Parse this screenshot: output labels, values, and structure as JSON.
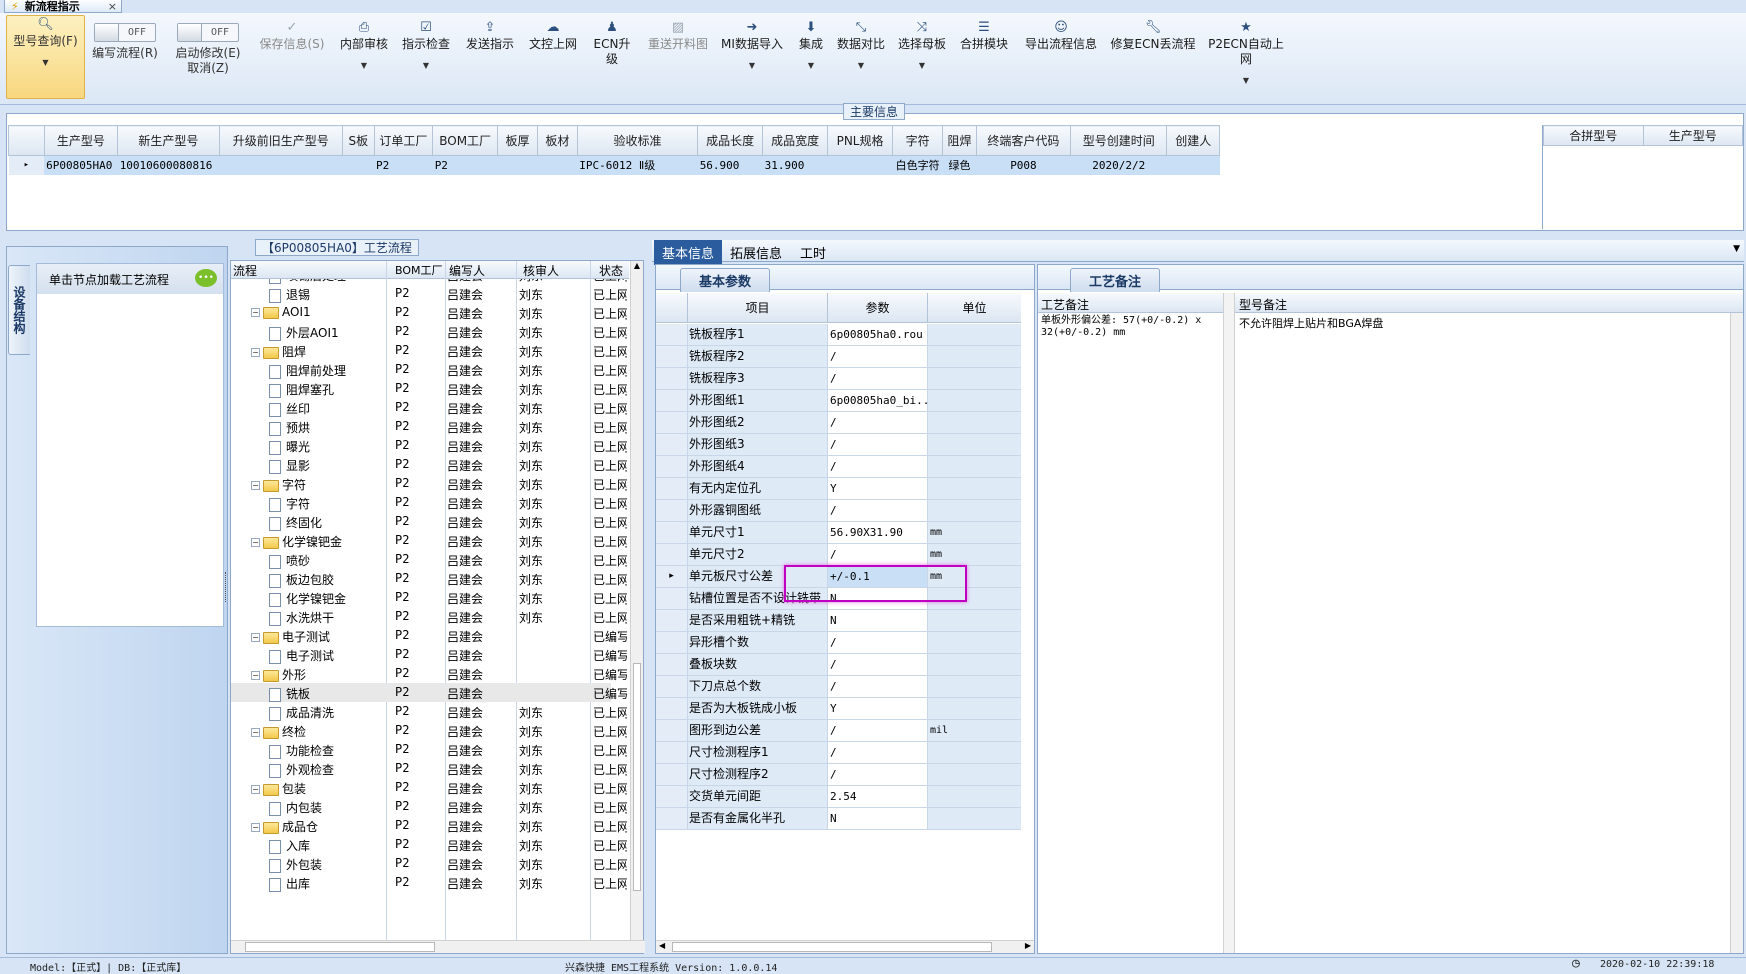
{
  "doc_tab": {
    "title": "新流程指示",
    "close": "×"
  },
  "toolbar": {
    "query": "型号查询(F)",
    "write_flow": "编写流程(R)",
    "start_edit": "启动修改(E)",
    "cancel": "取消(Z)",
    "off": "OFF",
    "save_info": "保存信息(S)",
    "internal_review": "内部审核",
    "instruction_check": "指示检查",
    "send_instruction": "发送指示",
    "doc_upload": "文控上网",
    "ecn_upgrade": "ECN升级",
    "resend_material": "重送开料图",
    "mi_import": "MI数据导入",
    "integrate": "集成",
    "data_compare": "数据对比",
    "select_master": "选择母板",
    "merge_module": "合拼模块",
    "export_flow": "导出流程信息",
    "repair_ecn": "修复ECN丢流程",
    "p2ecn_upload": "P2ECN自动上网"
  },
  "main_info": {
    "section_title": "主要信息",
    "columns": [
      "生产型号",
      "新生产型号",
      "升级前旧生产型号",
      "S板",
      "订单工厂",
      "BOM工厂",
      "板厚",
      "板材",
      "验收标准",
      "成品长度",
      "成品宽度",
      "PNL规格",
      "字符",
      "阻焊",
      "终端客户代码",
      "型号创建时间",
      "创建人"
    ],
    "row": [
      "6P00805HA0",
      "10010600080816",
      "",
      "",
      "P2",
      "P2",
      "",
      "",
      "IPC-6012 Ⅱ级",
      "56.900",
      "31.900",
      "",
      "白色字符",
      "绿色",
      "P008",
      "2020/2/2",
      ""
    ],
    "side_columns": [
      "合拼型号",
      "生产型号"
    ]
  },
  "left_panel": {
    "vertical_tab": "设备结构",
    "hint": "单击节点加载工艺流程"
  },
  "flow": {
    "title": "【6P00805HA0】工艺流程",
    "columns": [
      "流程",
      "BOM工厂",
      "编写人",
      "核审人",
      "状态"
    ],
    "rows": [
      {
        "name": "喷锡后处理",
        "level": 1,
        "f": "P2",
        "w": "吕建会",
        "r": "刘东",
        "s": "已上网"
      },
      {
        "name": "退锡",
        "level": 1,
        "f": "P2",
        "w": "吕建会",
        "r": "刘东",
        "s": "已上网"
      },
      {
        "name": "AOI1",
        "level": 0,
        "f": "P2",
        "w": "吕建会",
        "r": "刘东",
        "s": "已上网"
      },
      {
        "name": "外层AOI1",
        "level": 1,
        "f": "P2",
        "w": "吕建会",
        "r": "刘东",
        "s": "已上网"
      },
      {
        "name": "阻焊",
        "level": 0,
        "f": "P2",
        "w": "吕建会",
        "r": "刘东",
        "s": "已上网"
      },
      {
        "name": "阻焊前处理",
        "level": 1,
        "f": "P2",
        "w": "吕建会",
        "r": "刘东",
        "s": "已上网"
      },
      {
        "name": "阻焊塞孔",
        "level": 1,
        "f": "P2",
        "w": "吕建会",
        "r": "刘东",
        "s": "已上网"
      },
      {
        "name": "丝印",
        "level": 1,
        "f": "P2",
        "w": "吕建会",
        "r": "刘东",
        "s": "已上网"
      },
      {
        "name": "预烘",
        "level": 1,
        "f": "P2",
        "w": "吕建会",
        "r": "刘东",
        "s": "已上网"
      },
      {
        "name": "曝光",
        "level": 1,
        "f": "P2",
        "w": "吕建会",
        "r": "刘东",
        "s": "已上网"
      },
      {
        "name": "显影",
        "level": 1,
        "f": "P2",
        "w": "吕建会",
        "r": "刘东",
        "s": "已上网"
      },
      {
        "name": "字符",
        "level": 0,
        "f": "P2",
        "w": "吕建会",
        "r": "刘东",
        "s": "已上网"
      },
      {
        "name": "字符",
        "level": 1,
        "f": "P2",
        "w": "吕建会",
        "r": "刘东",
        "s": "已上网"
      },
      {
        "name": "终固化",
        "level": 1,
        "f": "P2",
        "w": "吕建会",
        "r": "刘东",
        "s": "已上网"
      },
      {
        "name": "化学镍钯金",
        "level": 0,
        "f": "P2",
        "w": "吕建会",
        "r": "刘东",
        "s": "已上网"
      },
      {
        "name": "喷砂",
        "level": 1,
        "f": "P2",
        "w": "吕建会",
        "r": "刘东",
        "s": "已上网"
      },
      {
        "name": "板边包胶",
        "level": 1,
        "f": "P2",
        "w": "吕建会",
        "r": "刘东",
        "s": "已上网"
      },
      {
        "name": "化学镍钯金",
        "level": 1,
        "f": "P2",
        "w": "吕建会",
        "r": "刘东",
        "s": "已上网"
      },
      {
        "name": "水洗烘干",
        "level": 1,
        "f": "P2",
        "w": "吕建会",
        "r": "刘东",
        "s": "已上网"
      },
      {
        "name": "电子测试",
        "level": 0,
        "f": "P2",
        "w": "吕建会",
        "r": "",
        "s": "已编写"
      },
      {
        "name": "电子测试",
        "level": 1,
        "f": "P2",
        "w": "吕建会",
        "r": "",
        "s": "已编写"
      },
      {
        "name": "外形",
        "level": 0,
        "f": "P2",
        "w": "吕建会",
        "r": "",
        "s": "已编写"
      },
      {
        "name": "铣板",
        "level": 1,
        "f": "P2",
        "w": "吕建会",
        "r": "",
        "s": "已编写",
        "hl": true
      },
      {
        "name": "成品清洗",
        "level": 1,
        "f": "P2",
        "w": "吕建会",
        "r": "刘东",
        "s": "已上网"
      },
      {
        "name": "终检",
        "level": 0,
        "f": "P2",
        "w": "吕建会",
        "r": "刘东",
        "s": "已上网"
      },
      {
        "name": "功能检查",
        "level": 1,
        "f": "P2",
        "w": "吕建会",
        "r": "刘东",
        "s": "已上网"
      },
      {
        "name": "外观检查",
        "level": 1,
        "f": "P2",
        "w": "吕建会",
        "r": "刘东",
        "s": "已上网"
      },
      {
        "name": "包装",
        "level": 0,
        "f": "P2",
        "w": "吕建会",
        "r": "刘东",
        "s": "已上网"
      },
      {
        "name": "内包装",
        "level": 1,
        "f": "P2",
        "w": "吕建会",
        "r": "刘东",
        "s": "已上网"
      },
      {
        "name": "成品仓",
        "level": 0,
        "f": "P2",
        "w": "吕建会",
        "r": "刘东",
        "s": "已上网"
      },
      {
        "name": "入库",
        "level": 1,
        "f": "P2",
        "w": "吕建会",
        "r": "刘东",
        "s": "已上网"
      },
      {
        "name": "外包装",
        "level": 1,
        "f": "P2",
        "w": "吕建会",
        "r": "刘东",
        "s": "已上网"
      },
      {
        "name": "出库",
        "level": 1,
        "f": "P2",
        "w": "吕建会",
        "r": "刘东",
        "s": "已上网"
      }
    ]
  },
  "detail": {
    "tabs": [
      "基本信息",
      "拓展信息",
      "工时"
    ],
    "sub_tab": "基本参数",
    "columns": [
      "项目",
      "参数",
      "单位"
    ],
    "params": [
      {
        "n": "铣板程序1",
        "v": "6p00805ha0.rou",
        "u": ""
      },
      {
        "n": "铣板程序2",
        "v": "/",
        "u": ""
      },
      {
        "n": "铣板程序3",
        "v": "/",
        "u": ""
      },
      {
        "n": "外形图纸1",
        "v": "6p00805ha0_bi...",
        "u": ""
      },
      {
        "n": "外形图纸2",
        "v": "/",
        "u": ""
      },
      {
        "n": "外形图纸3",
        "v": "/",
        "u": ""
      },
      {
        "n": "外形图纸4",
        "v": "/",
        "u": ""
      },
      {
        "n": "有无内定位孔",
        "v": "Y",
        "u": ""
      },
      {
        "n": "外形露铜图纸",
        "v": "/",
        "u": ""
      },
      {
        "n": "单元尺寸1",
        "v": "56.90X31.90",
        "u": "mm"
      },
      {
        "n": "单元尺寸2",
        "v": "/",
        "u": "mm"
      },
      {
        "n": "单元板尺寸公差",
        "v": "+/-0.1",
        "u": "mm"
      },
      {
        "n": "钻槽位置是否不设计铣带",
        "v": "N",
        "u": ""
      },
      {
        "n": "是否采用粗铣+精铣",
        "v": "N",
        "u": ""
      },
      {
        "n": "异形槽个数",
        "v": "/",
        "u": ""
      },
      {
        "n": "叠板块数",
        "v": "/",
        "u": ""
      },
      {
        "n": "下刀点总个数",
        "v": "/",
        "u": ""
      },
      {
        "n": "是否为大板铣成小板",
        "v": "Y",
        "u": ""
      },
      {
        "n": "图形到边公差",
        "v": "/",
        "u": "mil"
      },
      {
        "n": "尺寸检测程序1",
        "v": "/",
        "u": ""
      },
      {
        "n": "尺寸检测程序2",
        "v": "/",
        "u": ""
      },
      {
        "n": "交货单元间距",
        "v": "2.54",
        "u": ""
      },
      {
        "n": "是否有金属化半孔",
        "v": "N",
        "u": ""
      }
    ]
  },
  "notes": {
    "tab": "工艺备注",
    "col1": "工艺备注",
    "col2": "型号备注",
    "process_note": "单板外形偏公差: 57(+0/-0.2) x 32(+0/-0.2) mm",
    "model_note": "不允许阻焊上贴片和BGA焊盘"
  },
  "status": {
    "left": "Model:【正式】| DB:【正式库】",
    "center": "兴森快捷 EMS工程系统 Version: 1.0.0.14",
    "right": "2020-02-10 22:39:18"
  },
  "colors": {
    "accent": "#1c3a66",
    "selection": "#c9dff6",
    "highlight_box": "#c000c0",
    "tab_active": "#2b5c9e"
  }
}
